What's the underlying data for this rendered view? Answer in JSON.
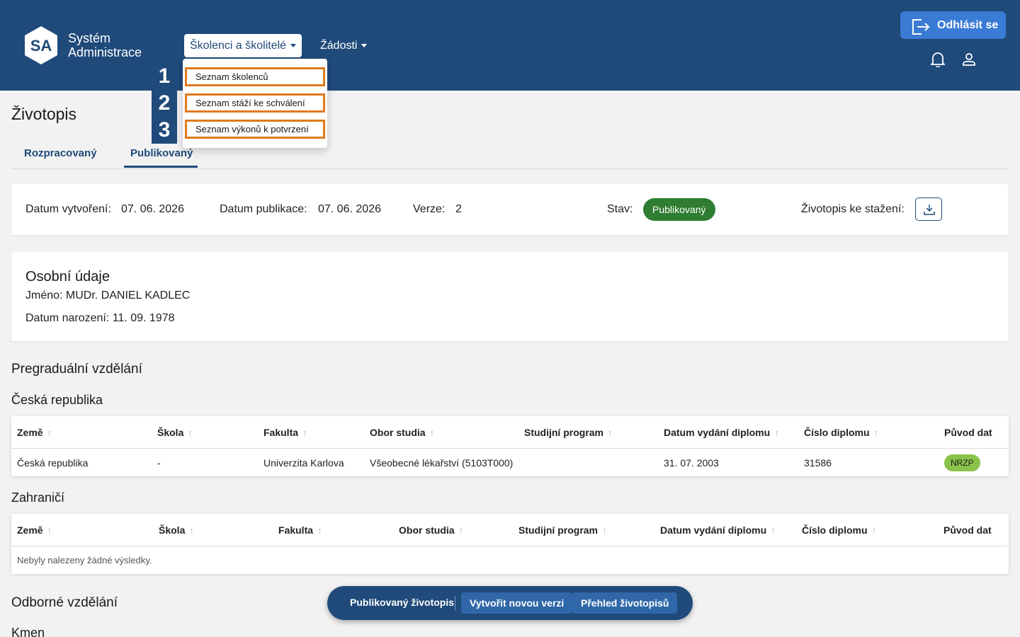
{
  "header": {
    "logo_text": "SA",
    "brand_line1": "Systém",
    "brand_line2": "Administrace",
    "nav": [
      {
        "label": "Školenci a školitelé"
      },
      {
        "label": "Žádosti"
      }
    ],
    "logout_label": "Odhlásit se"
  },
  "dropdown": {
    "items": [
      {
        "num": "1",
        "label": "Seznam školenců"
      },
      {
        "num": "2",
        "label": "Seznam stáží ke schválení"
      },
      {
        "num": "3",
        "label": "Seznam výkonů k potvrzení"
      }
    ]
  },
  "page": {
    "title": "Životopis",
    "tabs": [
      {
        "label": "Rozpracovaný"
      },
      {
        "label": "Publikovaný"
      }
    ]
  },
  "meta": {
    "created_label": "Datum vytvoření:",
    "created_value": "07. 06. 2026",
    "published_label": "Datum publikace:",
    "published_value": "07. 06. 2026",
    "version_label": "Verze:",
    "version_value": "2",
    "status_label": "Stav:",
    "status_value": "Publikovaný",
    "download_label": "Životopis ke stažení:",
    "status_color": "#2e7d32"
  },
  "personal": {
    "heading": "Osobní údaje",
    "name_line": "Jméno: MUDr. DANIEL KADLEC",
    "birth_line": "Datum narození: 11. 09. 1978"
  },
  "pregradual": {
    "heading": "Pregraduální vzdělání",
    "czech": {
      "heading": "Česká republika",
      "columns": [
        "Země",
        "Škola",
        "Fakulta",
        "Obor studia",
        "Studijní program",
        "Datum vydání diplomu",
        "Číslo diplomu",
        "Původ dat"
      ],
      "rows": [
        {
          "zeme": "Česká republika",
          "skola": "-",
          "fakulta": "Univerzita Karlova",
          "obor": "Všeobecné lékařství (5103T000)",
          "program": "",
          "datum": "31. 07. 2003",
          "cislo": "31586",
          "puvod": "NRZP"
        }
      ]
    },
    "foreign": {
      "heading": "Zahraničí",
      "columns": [
        "Země",
        "Škola",
        "Fakulta",
        "Obor studia",
        "Studijní program",
        "Datum vydání diplomu",
        "Číslo diplomu",
        "Původ dat"
      ],
      "empty_text": "Nebyly nalezeny žádné výsledky."
    }
  },
  "professional": {
    "heading": "Odborné vzdělání",
    "sub": "Kmen"
  },
  "bottom_bar": {
    "label": "Publikovaný životopis",
    "btn_new": "Vytvořit novou verzi",
    "btn_overview": "Přehled životopisů"
  },
  "icons": {
    "logout": "logout-icon",
    "bell": "bell-icon",
    "user": "user-icon",
    "download": "download-icon",
    "sort": "sort-arrow-up-icon"
  }
}
